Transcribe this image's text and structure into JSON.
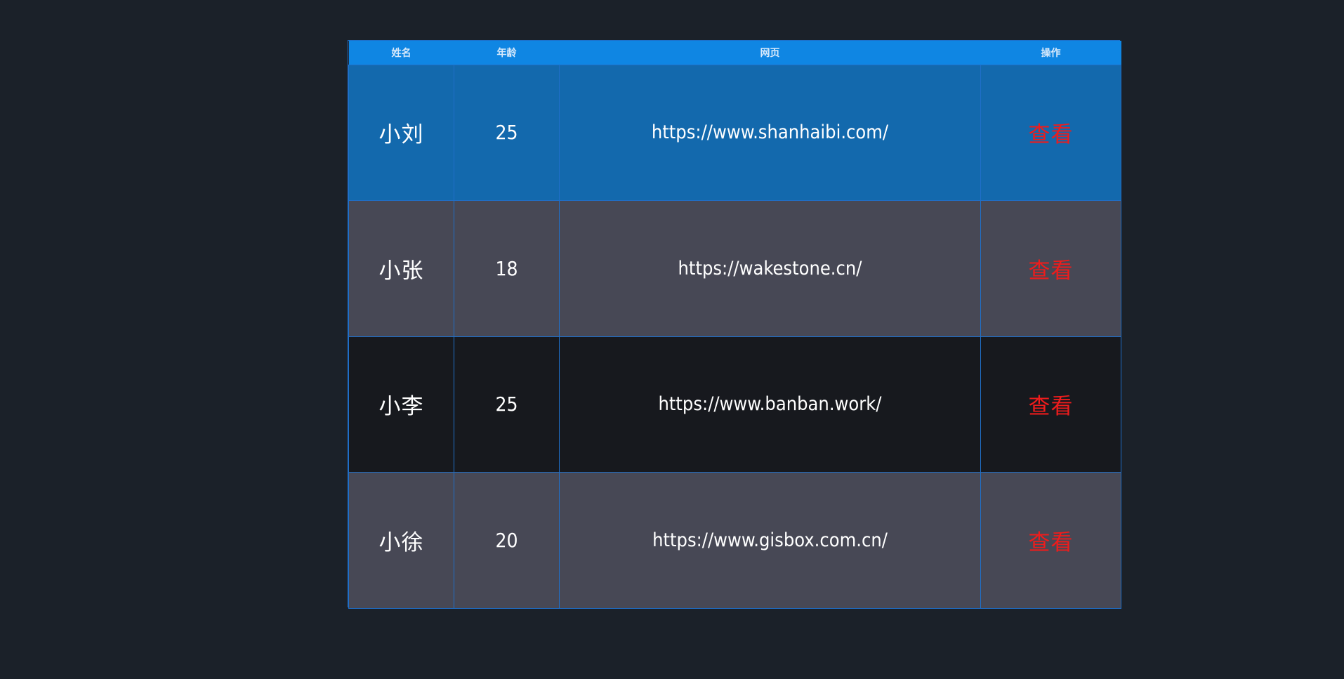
{
  "table": {
    "headers": [
      "姓名",
      "年龄",
      "网页",
      "操作"
    ],
    "rows": [
      {
        "name": "小刘",
        "age": "25",
        "web": "https://www.shanhaibi.com/",
        "action": "查看"
      },
      {
        "name": "小张",
        "age": "18",
        "web": "https://wakestone.cn/",
        "action": "查看"
      },
      {
        "name": "小李",
        "age": "25",
        "web": "https://www.banban.work/",
        "action": "查看"
      },
      {
        "name": "小徐",
        "age": "20",
        "web": "https://www.gisbox.com.cn/",
        "action": "查看"
      }
    ]
  },
  "colors": {
    "background": "#1b2129",
    "header": "#0f86e3",
    "row_highlight": "#1369ad",
    "row_gray": "#474855",
    "row_dark": "#17191e",
    "border": "#1f6fc8",
    "action_text": "#ee1c1c"
  }
}
